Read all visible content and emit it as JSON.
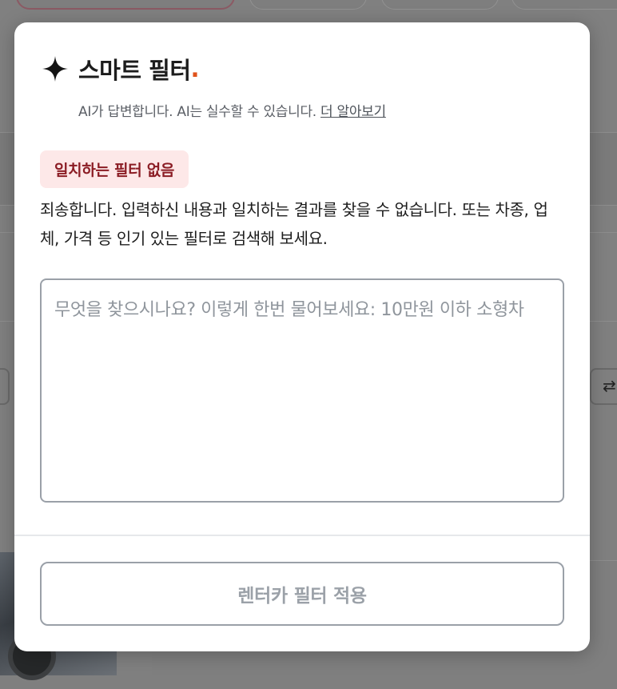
{
  "dialog": {
    "icon": "sparkle-icon",
    "title": "스마트 필터",
    "title_dot": ".",
    "disclaimer_text": "AI가 답변합니다. AI는 실수할 수 있습니다. ",
    "learn_more_label": "더 알아보기",
    "no_match_badge": "일치하는 필터 없음",
    "message": "죄송합니다. 입력하신 내용과 일치하는 결과를 찾을 수 없습니다. 또는 차종, 업체, 가격 등 인기 있는 필터로 검색해 보세요.",
    "query": {
      "value": "",
      "placeholder": "무엇을 찾으시나요? 이렇게 한번 물어보세요: 10만원 이하 소형차"
    },
    "apply_button_label": "렌터카 필터 적용"
  },
  "colors": {
    "accent_dot": "#e0531b",
    "badge_bg": "#fde8e8",
    "badge_text": "#8b1c24",
    "disabled_text": "#9ba1a8"
  }
}
